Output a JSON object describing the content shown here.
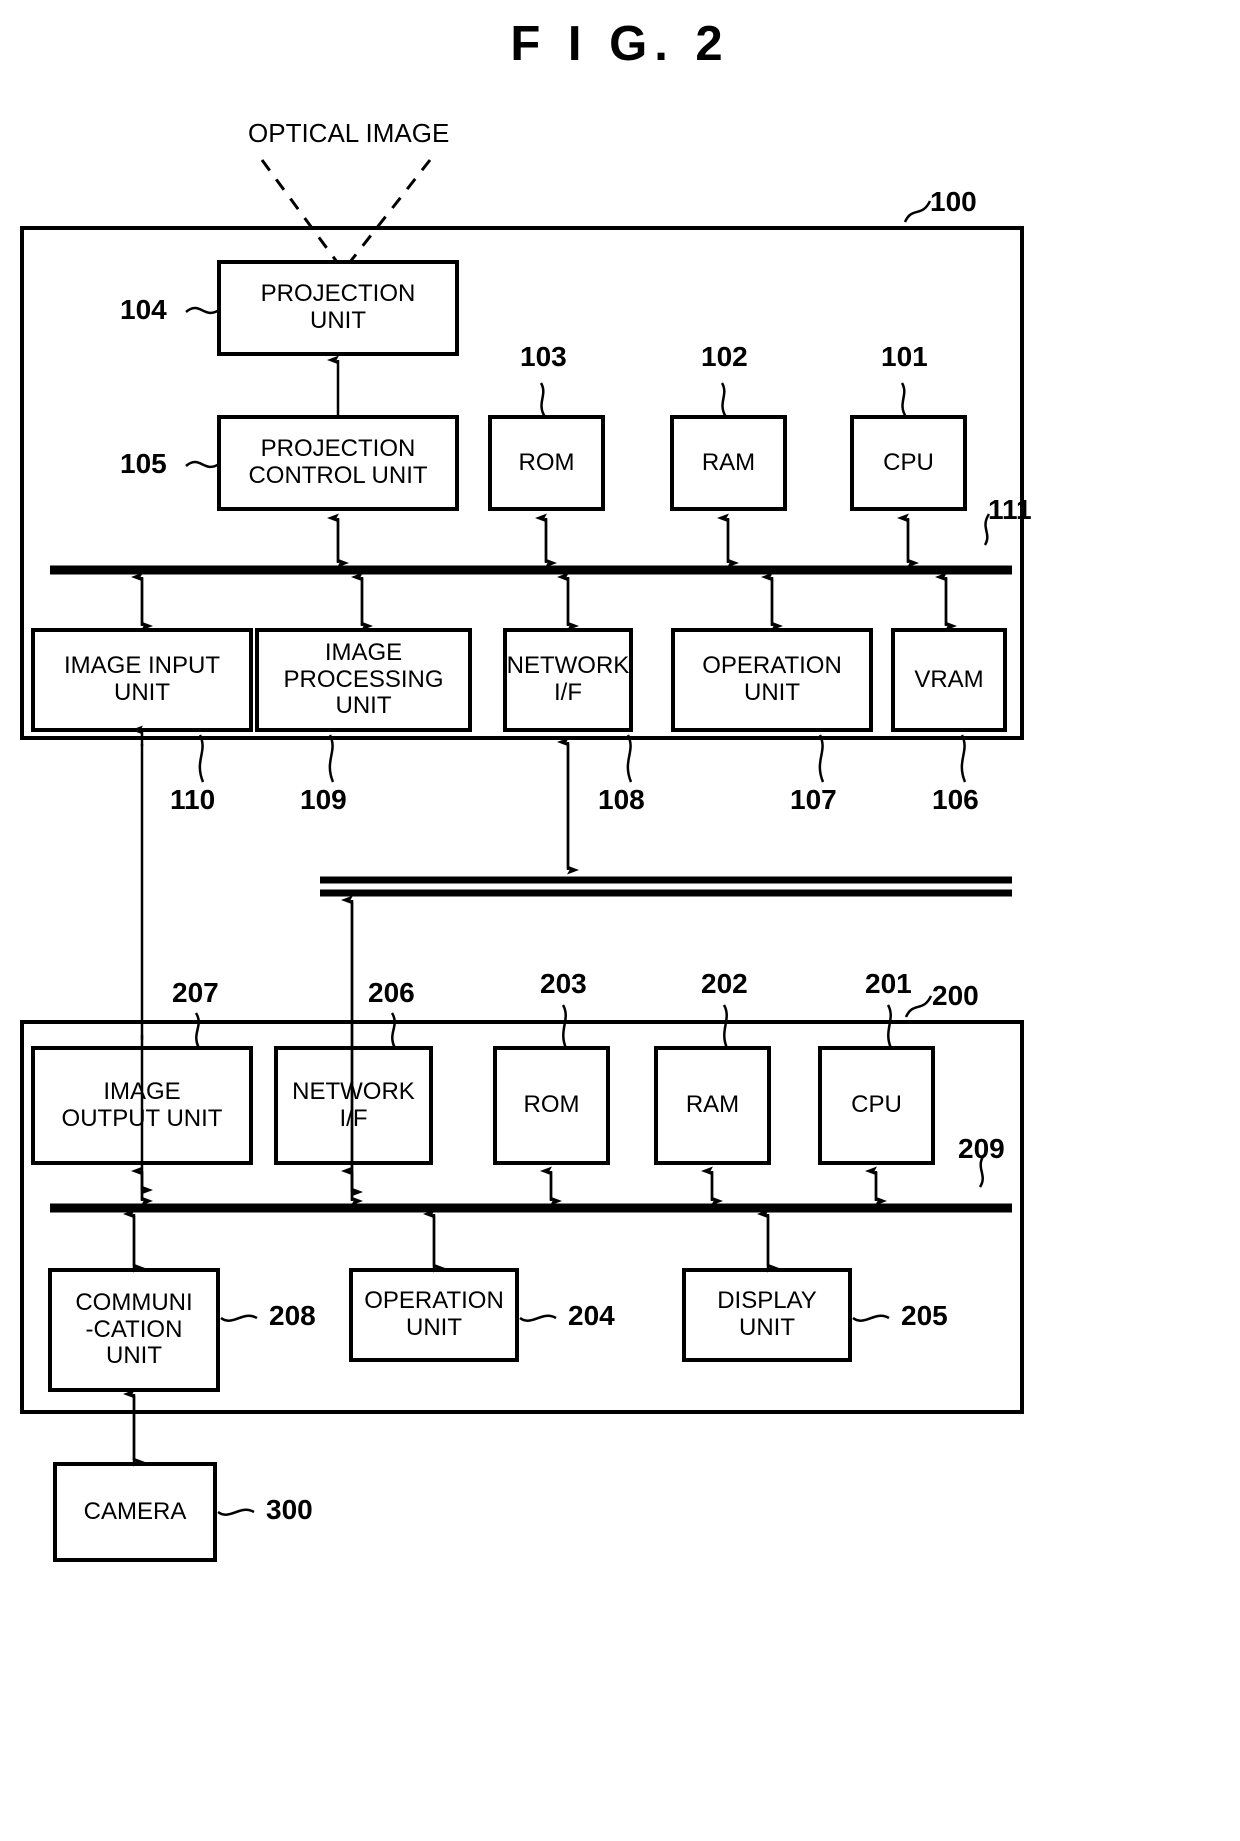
{
  "figure": {
    "title": "F I G.  2",
    "optical_image_label": "OPTICAL IMAGE"
  },
  "projector": {
    "ref": "100",
    "bus_ref": "111",
    "blocks": [
      {
        "id": "projection-unit",
        "label": "PROJECTION\nUNIT",
        "ref": "104"
      },
      {
        "id": "projection-control-unit",
        "label": "PROJECTION\nCONTROL UNIT",
        "ref": "105"
      },
      {
        "id": "rom",
        "label": "ROM",
        "ref": "103"
      },
      {
        "id": "ram",
        "label": "RAM",
        "ref": "102"
      },
      {
        "id": "cpu",
        "label": "CPU",
        "ref": "101"
      },
      {
        "id": "image-input-unit",
        "label": "IMAGE INPUT\nUNIT",
        "ref": "110"
      },
      {
        "id": "image-processing-unit",
        "label": "IMAGE\nPROCESSING\nUNIT",
        "ref": "109"
      },
      {
        "id": "network-if",
        "label": "NETWORK\nI/F",
        "ref": "108"
      },
      {
        "id": "operation-unit",
        "label": "OPERATION\nUNIT",
        "ref": "107"
      },
      {
        "id": "vram",
        "label": "VRAM",
        "ref": "106"
      }
    ]
  },
  "controller": {
    "ref": "200",
    "bus_ref": "209",
    "blocks": [
      {
        "id": "image-output-unit",
        "label": "IMAGE\nOUTPUT UNIT",
        "ref": "207"
      },
      {
        "id": "network-if",
        "label": "NETWORK\nI/F",
        "ref": "206"
      },
      {
        "id": "rom",
        "label": "ROM",
        "ref": "203"
      },
      {
        "id": "ram",
        "label": "RAM",
        "ref": "202"
      },
      {
        "id": "cpu",
        "label": "CPU",
        "ref": "201"
      },
      {
        "id": "communication-unit",
        "label": "COMMUNI\n-CATION\nUNIT",
        "ref": "208"
      },
      {
        "id": "operation-unit",
        "label": "OPERATION\nUNIT",
        "ref": "204"
      },
      {
        "id": "display-unit",
        "label": "DISPLAY\nUNIT",
        "ref": "205"
      }
    ]
  },
  "camera": {
    "label": "CAMERA",
    "ref": "300"
  }
}
